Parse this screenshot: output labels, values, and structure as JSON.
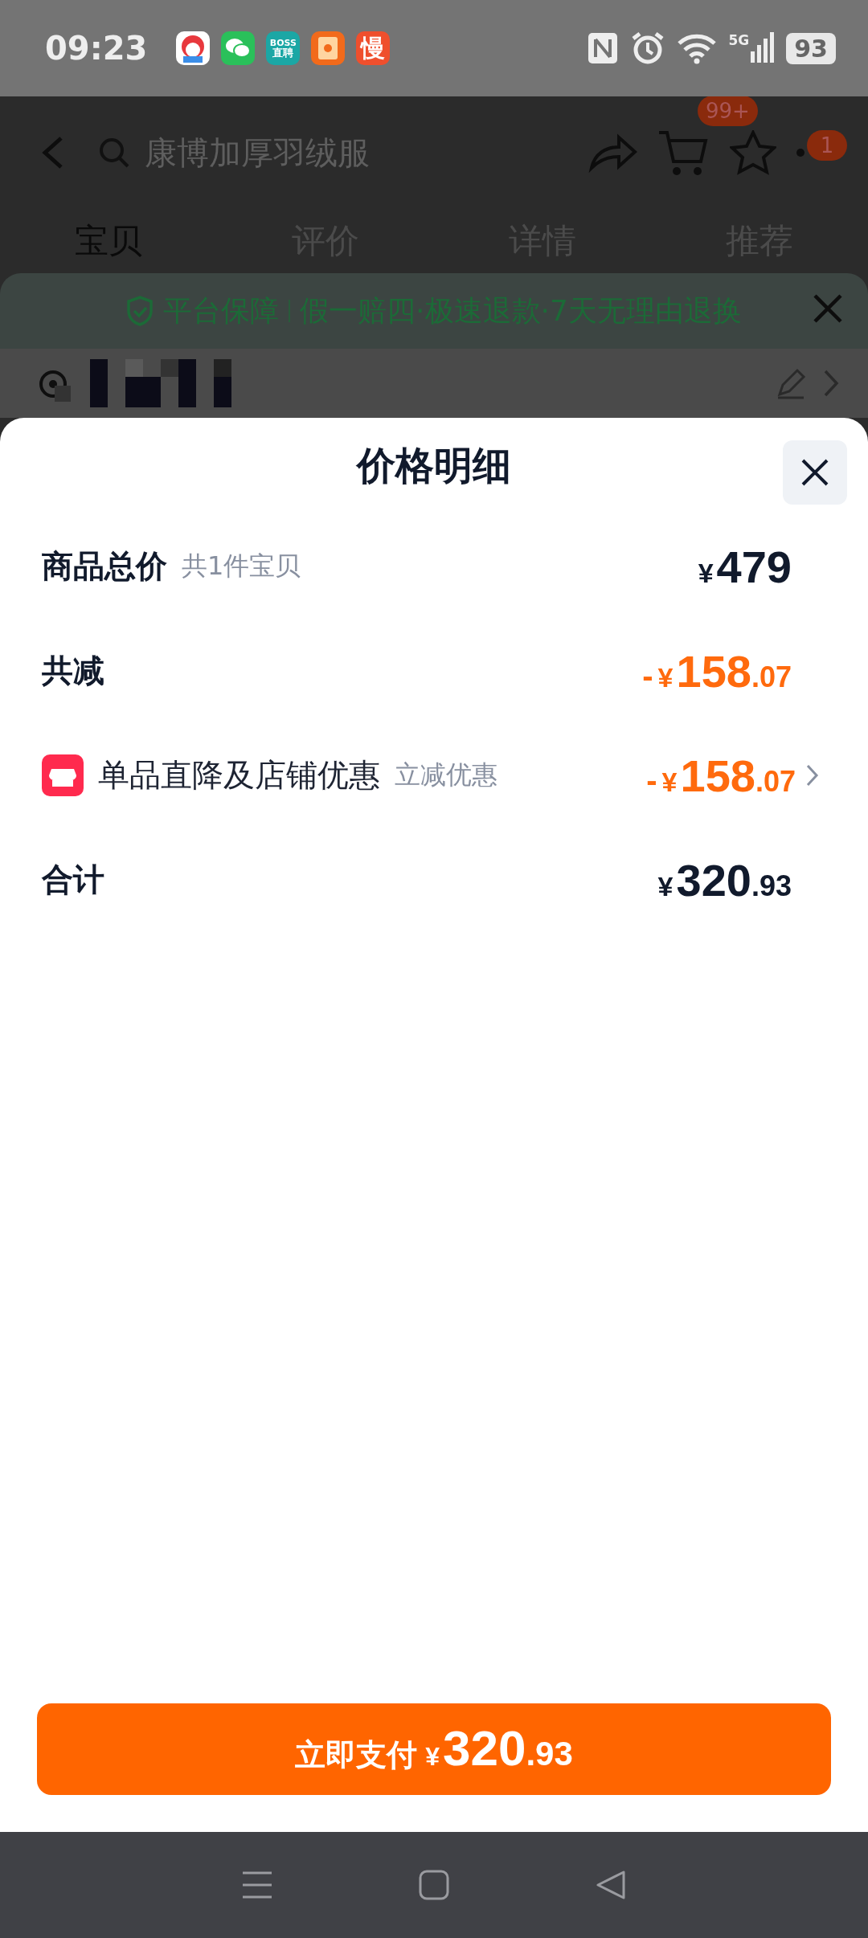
{
  "status_bar": {
    "time": "09:23",
    "notification_icons": [
      {
        "kind": "mascot"
      },
      {
        "kind": "chat"
      },
      {
        "kind": "boss",
        "label": "BOSS",
        "sublabel": "直聘"
      },
      {
        "kind": "envelope"
      },
      {
        "kind": "slow",
        "label": "慢"
      }
    ],
    "network": "5G",
    "battery": "93"
  },
  "header": {
    "search_text": "康博加厚羽绒服",
    "cart_badge": "99+",
    "more_badge": "1"
  },
  "tabs": [
    {
      "label": "宝贝",
      "selected": true
    },
    {
      "label": "评价",
      "selected": false
    },
    {
      "label": "详情",
      "selected": false
    },
    {
      "label": "推荐",
      "selected": false
    }
  ],
  "guarantee": {
    "title": "平台保障",
    "text": "假一赔四·极速退款·7天无理由退换"
  },
  "sheet": {
    "title": "价格明细",
    "rows": [
      {
        "kind": "plain",
        "label": "商品总价",
        "note": "共1件宝贝",
        "price": {
          "currency": "¥",
          "integer": "479",
          "discount": false
        }
      },
      {
        "kind": "plain",
        "label": "共减",
        "price": {
          "sign": "-",
          "currency": "¥",
          "integer": "158",
          "decimal": ".07",
          "discount": true
        }
      },
      {
        "kind": "store_offer",
        "label": "单品直降及店铺优惠",
        "note": "立减优惠",
        "price": {
          "sign": "-",
          "currency": "¥",
          "integer": "158",
          "decimal": ".07",
          "discount": true
        }
      },
      {
        "kind": "plain",
        "label": "合计",
        "price": {
          "currency": "¥",
          "integer": "320",
          "decimal": ".93",
          "discount": false
        }
      }
    ]
  },
  "pay_button": {
    "label": "立即支付",
    "price": {
      "currency": "¥",
      "integer": "320",
      "decimal": ".93"
    }
  }
}
